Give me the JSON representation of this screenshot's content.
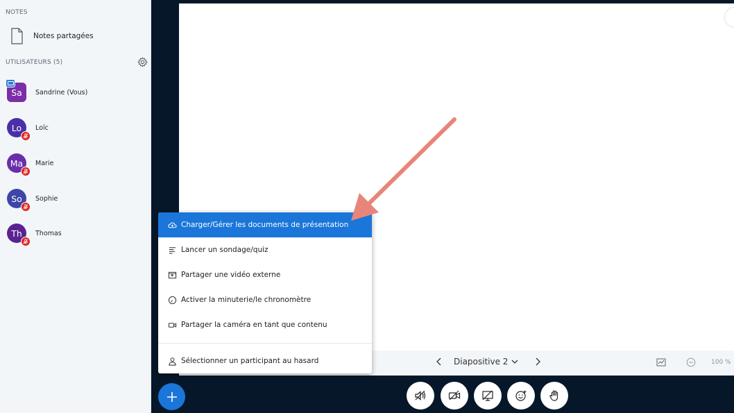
{
  "sidebar": {
    "notes_header": "NOTES",
    "shared_notes": "Notes partagées",
    "users_header": "UTILISATEURS (5)",
    "users": [
      {
        "initials": "Sa",
        "name": "Sandrine (Vous)",
        "color": "#7b2ea8",
        "presenter": true,
        "muted": false
      },
      {
        "initials": "Lo",
        "name": "Loïc",
        "color": "#4a2fa8",
        "presenter": false,
        "muted": true
      },
      {
        "initials": "Ma",
        "name": "Marie",
        "color": "#6a2eab",
        "presenter": false,
        "muted": true
      },
      {
        "initials": "So",
        "name": "Sophie",
        "color": "#3d45a8",
        "presenter": false,
        "muted": true
      },
      {
        "initials": "Th",
        "name": "Thomas",
        "color": "#5a2390",
        "presenter": false,
        "muted": true
      }
    ]
  },
  "presentation": {
    "slide_label": "Diapositive 2",
    "zoom": "100 %"
  },
  "menu": {
    "items": [
      {
        "label": "Charger/Gérer les documents de présentation",
        "icon": "cloud-upload-icon",
        "active": true
      },
      {
        "label": "Lancer un sondage/quiz",
        "icon": "poll-list-icon",
        "active": false
      },
      {
        "label": "Partager une vidéo externe",
        "icon": "external-video-icon",
        "active": false
      },
      {
        "label": "Activer la minuterie/le chronomètre",
        "icon": "timer-icon",
        "active": false
      },
      {
        "label": "Partager la caméra en tant que contenu",
        "icon": "camera-content-icon",
        "active": false
      },
      {
        "label": "Sélectionner un participant au hasard",
        "icon": "user-icon",
        "active": false
      }
    ]
  },
  "colors": {
    "accent": "#1b76d9",
    "muted_badge": "#df2721",
    "annotation_arrow": "#e8857a",
    "background": "#06172a"
  }
}
